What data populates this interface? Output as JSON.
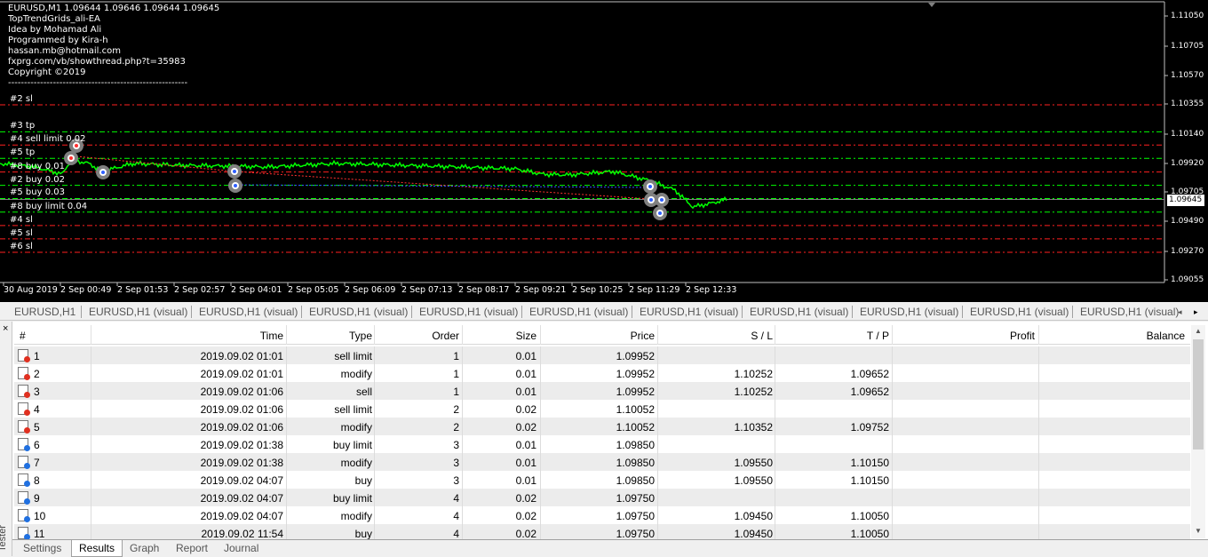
{
  "chart": {
    "header_lines": [
      "EURUSD,M1  1.09644 1.09646 1.09644 1.09645",
      "TopTrendGrids_ali-EA",
      "Idea by Mohamad Ali",
      "Programmed by Kira-h",
      "hassan.mb@hotmail.com",
      "fxprg.com/vb/showthread.php?t=35983",
      "Copyright ©2019",
      "--------------------------------------------------------"
    ],
    "grid_labels": [
      {
        "text": "#2 sl",
        "price": 1.10352,
        "color": "#ff2020"
      },
      {
        "text": "#3 tp",
        "price": 1.1015,
        "color": "#00ff00"
      },
      {
        "text": "#4 sell limit 0.02",
        "price": 1.10052,
        "color": "#ff2020"
      },
      {
        "text": "#5 tp",
        "price": 1.09952,
        "color": "#00ff00"
      },
      {
        "text": "#8 buy 0.01",
        "price": 1.0985,
        "color": "#ff2020"
      },
      {
        "text": "#2 buy 0.02",
        "price": 1.0975,
        "color": "#00ff00"
      },
      {
        "text": "#5 buy 0.03",
        "price": 1.09652,
        "color": "#00ff00"
      },
      {
        "text": "#8 buy limit 0.04",
        "price": 1.0955,
        "color": "#00ff00"
      },
      {
        "text": "#4 sl",
        "price": 1.0945,
        "color": "#ff2020"
      },
      {
        "text": "#5 sl",
        "price": 1.0935,
        "color": "#ff2020"
      },
      {
        "text": "#6 sl",
        "price": 1.0925,
        "color": "#ff2020"
      }
    ],
    "price_axis": [
      "1.11050",
      "1.10705",
      "1.10570",
      "1.10355",
      "1.10140",
      "1.09920",
      "1.09705",
      "1.09490",
      "1.09270",
      "1.09055"
    ],
    "current_price": "1.09645",
    "time_axis": [
      "30 Aug 2019",
      "2 Sep 00:49",
      "2 Sep 01:53",
      "2 Sep 02:57",
      "2 Sep 04:01",
      "2 Sep 05:05",
      "2 Sep 06:09",
      "2 Sep 07:13",
      "2 Sep 08:17",
      "2 Sep 09:21",
      "2 Sep 10:25",
      "2 Sep 11:29",
      "2 Sep 12:33"
    ],
    "colors": {
      "background": "#000000",
      "price_line": "#00ff00",
      "sell_line": "#ff2020",
      "tp_line": "#00ff00"
    }
  },
  "chart_tabs": [
    "EURUSD,H1",
    "EURUSD,H1 (visual)",
    "EURUSD,H1 (visual)",
    "EURUSD,H1 (visual)",
    "EURUSD,H1 (visual)",
    "EURUSD,H1 (visual)",
    "EURUSD,H1 (visual)",
    "EURUSD,H1 (visual)",
    "EURUSD,H1 (visual)",
    "EURUSD,H1 (visual)",
    "EURUSD,H1 (visual)"
  ],
  "tester": {
    "side_label": "Tester",
    "close": "×",
    "columns": [
      "#",
      "Time",
      "Type",
      "Order",
      "Size",
      "Price",
      "S / L",
      "T / P",
      "Profit",
      "Balance"
    ],
    "rows": [
      {
        "n": "1",
        "time": "2019.09.02 01:01",
        "type": "sell limit",
        "order": "1",
        "size": "0.01",
        "price": "1.09952",
        "sl": "",
        "tp": "",
        "side": "sell"
      },
      {
        "n": "2",
        "time": "2019.09.02 01:01",
        "type": "modify",
        "order": "1",
        "size": "0.01",
        "price": "1.09952",
        "sl": "1.10252",
        "tp": "1.09652",
        "side": "sell"
      },
      {
        "n": "3",
        "time": "2019.09.02 01:06",
        "type": "sell",
        "order": "1",
        "size": "0.01",
        "price": "1.09952",
        "sl": "1.10252",
        "tp": "1.09652",
        "side": "sell"
      },
      {
        "n": "4",
        "time": "2019.09.02 01:06",
        "type": "sell limit",
        "order": "2",
        "size": "0.02",
        "price": "1.10052",
        "sl": "",
        "tp": "",
        "side": "sell"
      },
      {
        "n": "5",
        "time": "2019.09.02 01:06",
        "type": "modify",
        "order": "2",
        "size": "0.02",
        "price": "1.10052",
        "sl": "1.10352",
        "tp": "1.09752",
        "side": "sell"
      },
      {
        "n": "6",
        "time": "2019.09.02 01:38",
        "type": "buy limit",
        "order": "3",
        "size": "0.01",
        "price": "1.09850",
        "sl": "",
        "tp": "",
        "side": "buy"
      },
      {
        "n": "7",
        "time": "2019.09.02 01:38",
        "type": "modify",
        "order": "3",
        "size": "0.01",
        "price": "1.09850",
        "sl": "1.09550",
        "tp": "1.10150",
        "side": "buy"
      },
      {
        "n": "8",
        "time": "2019.09.02 04:07",
        "type": "buy",
        "order": "3",
        "size": "0.01",
        "price": "1.09850",
        "sl": "1.09550",
        "tp": "1.10150",
        "side": "buy"
      },
      {
        "n": "9",
        "time": "2019.09.02 04:07",
        "type": "buy limit",
        "order": "4",
        "size": "0.02",
        "price": "1.09750",
        "sl": "",
        "tp": "",
        "side": "buy"
      },
      {
        "n": "10",
        "time": "2019.09.02 04:07",
        "type": "modify",
        "order": "4",
        "size": "0.02",
        "price": "1.09750",
        "sl": "1.09450",
        "tp": "1.10050",
        "side": "buy"
      },
      {
        "n": "11",
        "time": "2019.09.02 11:54",
        "type": "buy",
        "order": "4",
        "size": "0.02",
        "price": "1.09750",
        "sl": "1.09450",
        "tp": "1.10050",
        "side": "buy"
      }
    ],
    "bottom_tabs": [
      "Settings",
      "Results",
      "Graph",
      "Report",
      "Journal"
    ],
    "active_tab": "Results"
  }
}
